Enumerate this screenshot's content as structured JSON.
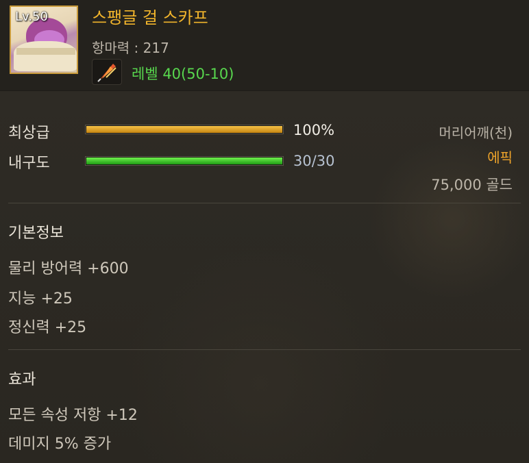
{
  "item": {
    "level_badge": "Lv.50",
    "name": "스팽글 걸 스카프",
    "magic_resistance": "항마력 : 217",
    "level_range": "레벨 40(50-10)"
  },
  "stats": [
    {
      "label": "최상급",
      "value": "100%",
      "fill": 1.0,
      "color": "#f0b035",
      "text_color": "#f2eee6"
    },
    {
      "label": "내구도",
      "value": "30/30",
      "fill": 1.0,
      "color": "#4fd23c",
      "text_color": "#b7c2d1"
    }
  ],
  "meta": {
    "category": "머리어깨(천)",
    "rarity": "에픽",
    "price": "75,000 골드"
  },
  "basic_info": {
    "title": "기본정보",
    "lines": [
      "물리 방어력 +600",
      "지능 +25",
      "정신력 +25"
    ]
  },
  "effects": {
    "title": "효과",
    "lines": [
      "모든 속성 저항 +12",
      "데미지 5% 증가"
    ]
  }
}
